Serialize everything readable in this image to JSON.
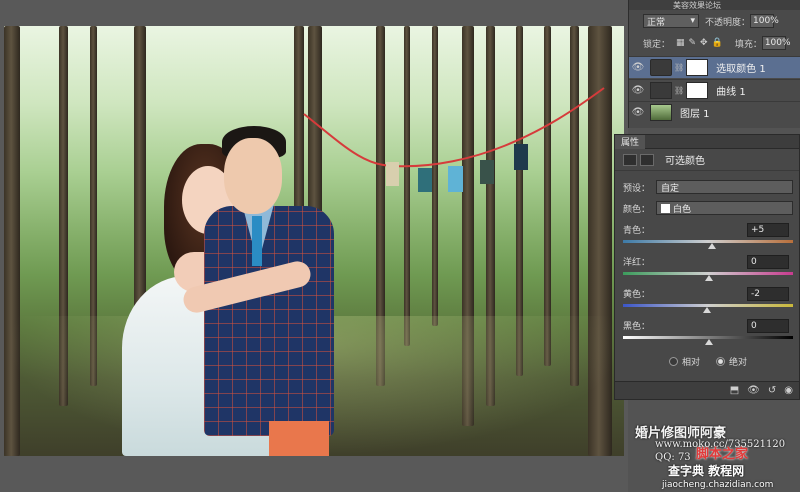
{
  "app": {
    "title_partial": "美容效果论坛"
  },
  "layers": {
    "blend_mode": "正常",
    "opacity_label": "不透明度：",
    "opacity_value": "100%",
    "lock_label": "锁定：",
    "fill_label": "填充：",
    "fill_value": "100%",
    "items": [
      {
        "name": "选取颜色 1",
        "kind": "adjustment",
        "active": true
      },
      {
        "name": "曲线 1",
        "kind": "adjustment",
        "active": false
      },
      {
        "name": "图层 1",
        "kind": "pixel",
        "active": false
      }
    ]
  },
  "properties": {
    "tab": "属性",
    "title": "可选颜色",
    "preset_label": "预设：",
    "preset_value": "自定",
    "colors_label": "颜色：",
    "colors_value": "白色",
    "sliders": [
      {
        "label": "青色：",
        "value": "+5",
        "level": 0.52
      },
      {
        "label": "洋红：",
        "value": "0",
        "level": 0.5
      },
      {
        "label": "黄色：",
        "value": "-2",
        "level": 0.49
      },
      {
        "label": "黑色：",
        "value": "0",
        "level": 0.5
      }
    ],
    "method_relative": "相对",
    "method_absolute": "绝对",
    "method_selected": "absolute"
  },
  "watermark": {
    "title": "婚片修图师阿豪",
    "url": "www.moko.cc/735521120",
    "qq": "QQ: 73"
  },
  "site": {
    "name_red": "脚本之家",
    "name_white": "查字典 教程网",
    "url": "jiaocheng.chazidian.com"
  }
}
